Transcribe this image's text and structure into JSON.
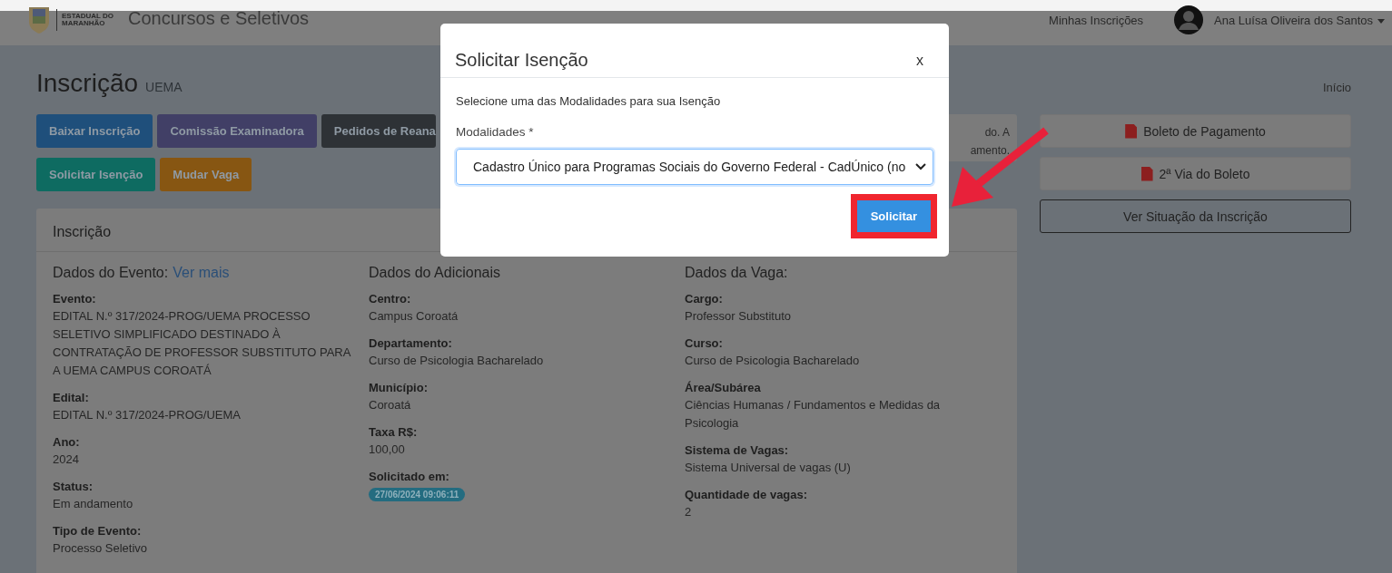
{
  "navbar": {
    "logo_lines": [
      "ESTADUAL DO",
      "MARANHÃO"
    ],
    "title": "Concursos e Seletivos",
    "links": [
      "Minhas Inscrições"
    ],
    "user": "Ana Luísa Oliveira dos Santos"
  },
  "page": {
    "title": "Inscrição",
    "subtitle": "UEMA",
    "breadcrumb": "Início"
  },
  "action_buttons": [
    {
      "label": "Baixar Inscrição",
      "color": "#1f4f7b"
    },
    {
      "label": "Comissão Examinadora",
      "color": "#413f66"
    },
    {
      "label": "Pedidos de Reana",
      "color": "#2e3236"
    },
    {
      "label": "Solicitar Isenção",
      "color": "#0e6b61"
    },
    {
      "label": "Mudar Vaga",
      "color": "#875612"
    }
  ],
  "alert": {
    "lines": [
      "do. A",
      "amento."
    ]
  },
  "side_buttons": [
    {
      "label": "Boleto de Pagamento",
      "kind": "pdf"
    },
    {
      "label": "2ª Via do Boleto",
      "kind": "pdf"
    },
    {
      "label": "Ver Situação da Inscrição",
      "kind": "outline"
    }
  ],
  "card": {
    "title": "Inscrição",
    "sections": [
      {
        "heading": "Dados do Evento:",
        "link": "Ver mais",
        "fields": [
          {
            "label": "Evento:",
            "value": "EDITAL N.º 317/2024-PROG/UEMA PROCESSO SELETIVO SIMPLIFICADO DESTINADO À CONTRATAÇÃO DE PROFESSOR SUBSTITUTO PARA A UEMA CAMPUS COROATÁ"
          },
          {
            "label": "Edital:",
            "value": "EDITAL N.º 317/2024-PROG/UEMA"
          },
          {
            "label": "Ano:",
            "value": "2024"
          },
          {
            "label": "Status:",
            "value": "Em andamento"
          },
          {
            "label": "Tipo de Evento:",
            "value": "Processo Seletivo"
          }
        ]
      },
      {
        "heading": "Dados do Adicionais",
        "fields": [
          {
            "label": "Centro:",
            "value": "Campus Coroatá"
          },
          {
            "label": "Departamento:",
            "value": "Curso de Psicologia Bacharelado"
          },
          {
            "label": "Município:",
            "value": "Coroatá"
          },
          {
            "label": "Taxa R$:",
            "value": "100,00"
          },
          {
            "label": "Solicitado em:",
            "value": "27/06/2024 09:06:11",
            "kind": "badge"
          }
        ]
      },
      {
        "heading": "Dados da Vaga:",
        "fields": [
          {
            "label": "Cargo:",
            "value": "Professor Substituto"
          },
          {
            "label": "Curso:",
            "value": "Curso de Psicologia Bacharelado"
          },
          {
            "label": "Área/Subárea",
            "value": "Ciências Humanas / Fundamentos e Medidas da Psicologia"
          },
          {
            "label": "Sistema de Vagas:",
            "value": "Sistema Universal de vagas (U)"
          },
          {
            "label": "Quantidade de vagas:",
            "value": "2"
          }
        ]
      }
    ]
  },
  "modal": {
    "title": "Solicitar Isenção",
    "close": "x",
    "instruction": "Selecione uma das Modalidades para sua Isenção",
    "field_label": "Modalidades *",
    "select_value": "Cadastro Único para Programas Sociais do Governo Federal - CadÚnico (no",
    "submit": "Solicitar",
    "highlighted": true
  }
}
